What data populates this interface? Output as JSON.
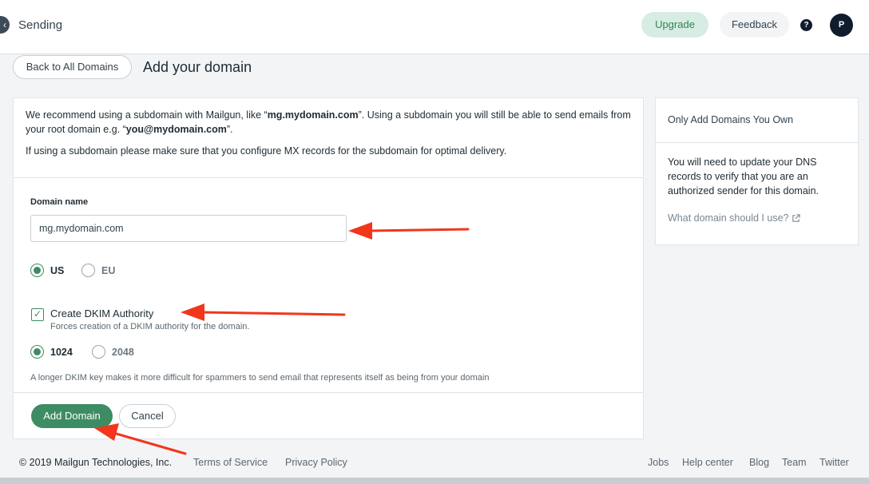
{
  "header": {
    "collapse_glyph": "‹",
    "section_title": "Sending",
    "upgrade_label": "Upgrade",
    "feedback_label": "Feedback",
    "help_glyph": "?",
    "avatar_initial": "P"
  },
  "page": {
    "back_label": "Back to All Domains",
    "title": "Add your domain"
  },
  "intro": {
    "p1_pre": "We recommend using a subdomain with Mailgun, like “",
    "p1_example": "mg.mydomain.com",
    "p1_mid": "”. Using a subdomain you will still be able to send emails from your root domain e.g. “",
    "p1_email": "you@mydomain.com",
    "p1_post": "”.",
    "p2": "If using a subdomain please make sure that you configure MX records for the subdomain for optimal delivery."
  },
  "form": {
    "domain_label": "Domain name",
    "domain_value": "mg.mydomain.com",
    "region_options": [
      {
        "label": "US",
        "selected": true
      },
      {
        "label": "EU",
        "selected": false
      }
    ],
    "dkim_checked": true,
    "dkim_label": "Create DKIM Authority",
    "dkim_help": "Forces creation of a DKIM authority for the domain.",
    "key_options": [
      {
        "label": "1024",
        "selected": true
      },
      {
        "label": "2048",
        "selected": false
      }
    ],
    "key_note": "A longer DKIM key makes it more difficult for spammers to send email that represents itself as being from your domain",
    "submit_label": "Add Domain",
    "cancel_label": "Cancel"
  },
  "side": {
    "title": "Only Add Domains You Own",
    "body": "You will need to update your DNS records to verify that you are an authorized sender for this domain.",
    "link_label": "What domain should I use?"
  },
  "footer": {
    "copyright": "© 2019 Mailgun Technologies, Inc.",
    "terms": "Terms of Service",
    "privacy": "Privacy Policy",
    "jobs": "Jobs",
    "help_center": "Help center",
    "blog": "Blog",
    "team": "Team",
    "twitter": "Twitter"
  },
  "colors": {
    "accent_green": "#3d8c63",
    "annotation_arrow": "#f2361c"
  },
  "icons": {
    "external_link": "external-link-icon",
    "check": "check-icon"
  }
}
